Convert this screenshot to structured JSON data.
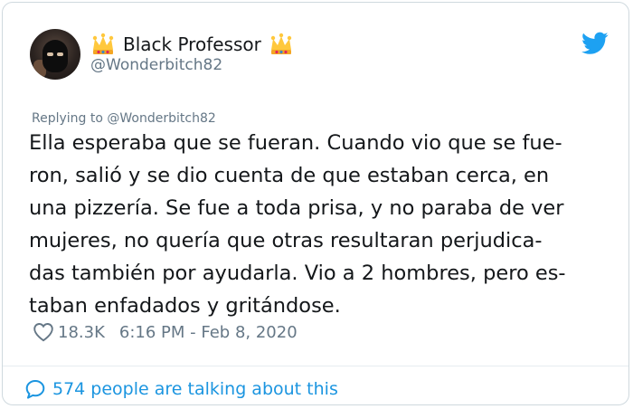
{
  "tweet": {
    "author_name": "Black Professor",
    "handle": "@Wonderbitch82",
    "replying_prefix": "Replying to",
    "replying_to": "@Wonderbitch82",
    "text": "Ella esperaba que se fueran. Cuando vio que se fue-\nron, salió y se dio cuenta de que estaban cerca, en\nuna pizzería. Se fue a toda prisa, y no paraba de ver\nmujeres, no quería que otras resultaran perjudica-\ndas también por ayudarla. Vio a 2 hombres, pero es-\ntaban enfadados y gritándose.",
    "likes": "18.3K",
    "timestamp": "6:16 PM - Feb 8, 2020",
    "talking_about": "574 people are talking about this"
  },
  "icons": {
    "crown": "crown-emoji-icon",
    "bird": "twitter-bird-icon",
    "heart": "heart-outline-icon",
    "bubble": "comment-bubble-icon"
  },
  "colors": {
    "link_blue": "#1b95e0",
    "secondary_gray": "#657786",
    "text": "#14171a",
    "border": "#cfd9de"
  }
}
